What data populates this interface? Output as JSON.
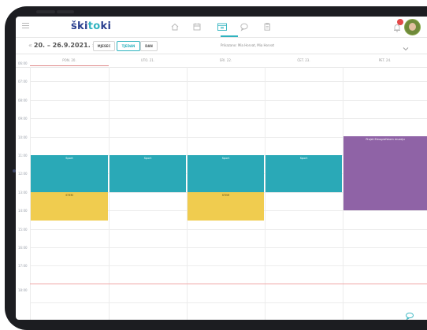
{
  "app": {
    "logo_prefix": "ški",
    "logo_o": "t",
    "logo_suffix": "ki"
  },
  "nav": {
    "icons": [
      "home-icon",
      "calendar-week-icon",
      "calendar-grid-icon",
      "chat-bubble-icon",
      "clipboard-icon"
    ],
    "active": "calendar-grid-icon"
  },
  "toolbar": {
    "date_range": "20. – 26.9.2021.",
    "views": [
      "MJESEC",
      "TJEDAN",
      "DAN"
    ],
    "active_view": "TJEDAN",
    "viewing_label": "Prikazano: Mia Horvat, Mia Horvat"
  },
  "days": [
    "PON. 20.",
    "UTO. 21.",
    "SRI. 22.",
    "ČET. 23.",
    "PET. 24."
  ],
  "times": [
    "06:00",
    "07:00",
    "08:00",
    "09:00",
    "10:00",
    "11:00",
    "12:00",
    "13:00",
    "14:00",
    "15:00",
    "16:00",
    "17:00",
    "18:00"
  ],
  "events": {
    "sport": "Sport",
    "stem": "STEM",
    "project": "Projet Etnografskom muzeju"
  },
  "colors": {
    "accent": "#2fb3bf",
    "sport": "#2aa9b7",
    "stem": "#f0cc4f",
    "project": "#8f63a6",
    "brand": "#2a3f8f",
    "now_line": "#f0a6a6"
  }
}
